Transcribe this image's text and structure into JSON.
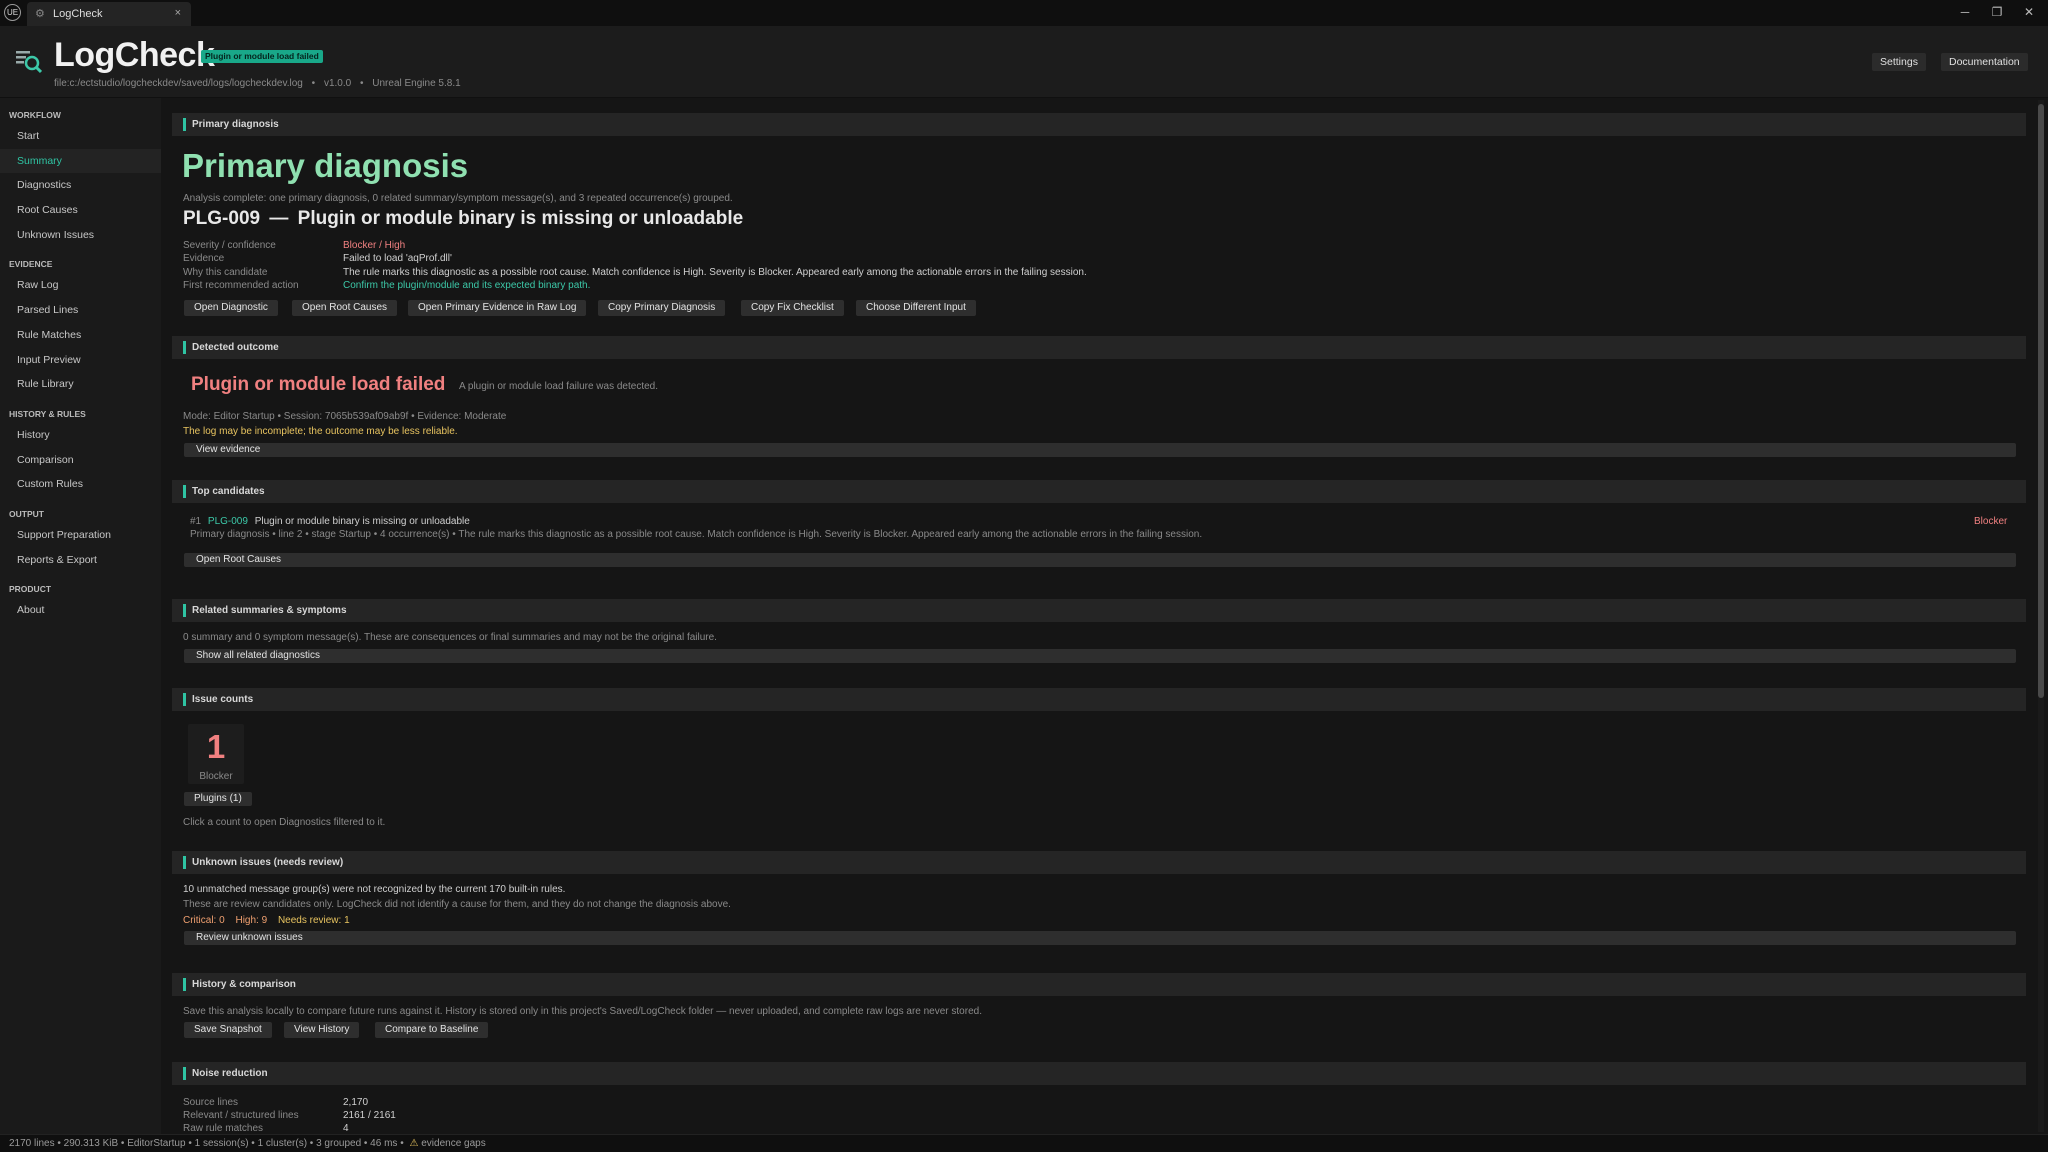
{
  "window": {
    "logo": "UE",
    "tab_icon": "logcheck-icon",
    "tab_title": "LogCheck",
    "close_glyph": "×",
    "minimize_glyph": "─",
    "maximize_glyph": "❐",
    "close_window_glyph": "✕"
  },
  "header": {
    "app_title": "LogCheck",
    "status_badge": "Plugin or module load failed",
    "file_path": "file:c:/ectstudio/logcheckdev/saved/logs/logcheckdev.log",
    "sep1": "•",
    "version": "v1.0.0",
    "sep2": "•",
    "engine": "Unreal Engine 5.8.1",
    "settings_label": "Settings",
    "documentation_label": "Documentation"
  },
  "sidebar": {
    "groups": [
      {
        "label": "WORKFLOW",
        "items": [
          "Start",
          "Summary",
          "Diagnostics",
          "Root Causes",
          "Unknown Issues"
        ]
      },
      {
        "label": "EVIDENCE",
        "items": [
          "Raw Log",
          "Parsed Lines",
          "Rule Matches",
          "Input Preview",
          "Rule Library"
        ]
      },
      {
        "label": "HISTORY & RULES",
        "items": [
          "History",
          "Comparison",
          "Custom Rules"
        ]
      },
      {
        "label": "OUTPUT",
        "items": [
          "Support Preparation",
          "Reports & Export"
        ]
      },
      {
        "label": "PRODUCT",
        "items": [
          "About"
        ]
      }
    ],
    "active_item": "Summary"
  },
  "primary": {
    "section_title": "Primary diagnosis",
    "heading": "Primary diagnosis",
    "summary": "Analysis complete: one primary diagnosis, 0 related summary/symptom message(s), and 3 repeated occurrence(s) grouped.",
    "code": "PLG-009",
    "dash": "—",
    "title": "Plugin or module binary is missing or unloadable",
    "fields": {
      "severity_label": "Severity / confidence",
      "severity_value": "Blocker / High",
      "evidence_label": "Evidence",
      "evidence_value": "Failed to load 'aqProf.dll'",
      "why_label": "Why this candidate",
      "why_value": "The rule marks this diagnostic as a possible root cause. Match confidence is High. Severity is Blocker. Appeared early among the actionable errors in the failing session.",
      "action_label": "First recommended action",
      "action_value": "Confirm the plugin/module and its expected binary path."
    },
    "buttons": [
      "Open Diagnostic",
      "Open Root Causes",
      "Open Primary Evidence in Raw Log",
      "Copy Primary Diagnosis",
      "Copy Fix Checklist",
      "Choose Different Input"
    ]
  },
  "outcome": {
    "section_title": "Detected outcome",
    "title": "Plugin or module load failed",
    "description": "A plugin or module load failure was detected.",
    "meta": "Mode: Editor Startup  •  Session: 7065b539af09ab9f  •  Evidence: Moderate",
    "warning": "The log may be incomplete; the outcome may be less reliable.",
    "view_evidence": "View evidence"
  },
  "candidates": {
    "section_title": "Top candidates",
    "rank": "#1",
    "code": "PLG-009",
    "title": "Plugin or module binary is missing or unloadable",
    "severity": "Blocker",
    "detail": "Primary diagnosis  •  line 2  •  stage Startup  •  4 occurrence(s)  •  The rule marks this diagnostic as a possible root cause. Match confidence is High. Severity is Blocker. Appeared early among the actionable errors in the failing session.",
    "button": "Open Root Causes"
  },
  "related": {
    "section_title": "Related summaries & symptoms",
    "text": "0 summary and 0 symptom message(s). These are consequences or final summaries and may not be the original failure.",
    "button": "Show all related diagnostics"
  },
  "counts": {
    "section_title": "Issue counts",
    "count_value": "1",
    "count_label": "Blocker",
    "plugins_button": "Plugins (1)",
    "hint": "Click a count to open Diagnostics filtered to it."
  },
  "unknown": {
    "section_title": "Unknown issues (needs review)",
    "line1": "10 unmatched message group(s) were not recognized by the current 170 built-in rules.",
    "line2": "These are review candidates only. LogCheck did not identify a cause for them, and they do not change the diagnosis above.",
    "critical": "Critical: 0",
    "high": "High: 9",
    "needs_review": "Needs review: 1",
    "button": "Review unknown issues"
  },
  "history": {
    "section_title": "History & comparison",
    "text": "Save this analysis locally to compare future runs against it. History is stored only in this project's Saved/LogCheck folder — never uploaded, and complete raw logs are never stored.",
    "buttons": [
      "Save Snapshot",
      "View History",
      "Compare to Baseline"
    ]
  },
  "noise": {
    "section_title": "Noise reduction",
    "rows": [
      {
        "label": "Source lines",
        "value": "2,170"
      },
      {
        "label": "Relevant / structured lines",
        "value": "2161 / 2161"
      },
      {
        "label": "Raw rule matches",
        "value": "4"
      }
    ]
  },
  "statusbar": {
    "text": "2170 lines  •  290.313 KiB  •  EditorStartup  •  1 session(s)  •  1 cluster(s)  •  3 grouped  •  46 ms  •",
    "warning_icon": "⚠",
    "warning_text": "evidence gaps"
  },
  "colors": {
    "accent": "#2fc4a3",
    "blocker": "#f08080",
    "warning": "#e8c460",
    "link": "#3cc8a8"
  }
}
